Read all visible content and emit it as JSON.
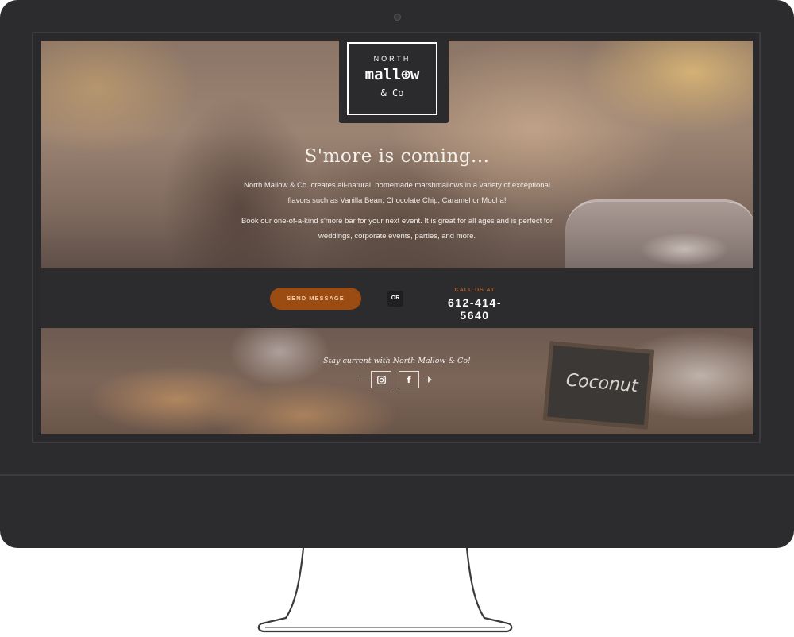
{
  "logo": {
    "line1": "NORTH",
    "line2": "mall⊕w",
    "line3": "& Co"
  },
  "hero": {
    "title": "S'more is coming...",
    "paragraph1": "North Mallow & Co. creates all-natural, homemade marshmallows in a variety of exceptional flavors such as Vanilla Bean, Chocolate Chip, Caramel or Mocha!",
    "paragraph2": "Book our one-of-a-kind s'more bar for your next event. It is great for all ages and is perfect for weddings, corporate events, parties, and more."
  },
  "contact": {
    "send_label": "SEND MESSAGE",
    "or_label": "OR",
    "call_label": "CALL US AT",
    "phone": "612-414-5640"
  },
  "social": {
    "tagline": "Stay current with North Mallow & Co!",
    "icons": [
      "instagram-icon",
      "facebook-icon"
    ],
    "facebook_glyph": "f"
  },
  "sign": {
    "text": "Coconut"
  },
  "colors": {
    "accent": "#9b4c12",
    "accent_text": "#b4612a",
    "dark": "#2c2b2e"
  }
}
